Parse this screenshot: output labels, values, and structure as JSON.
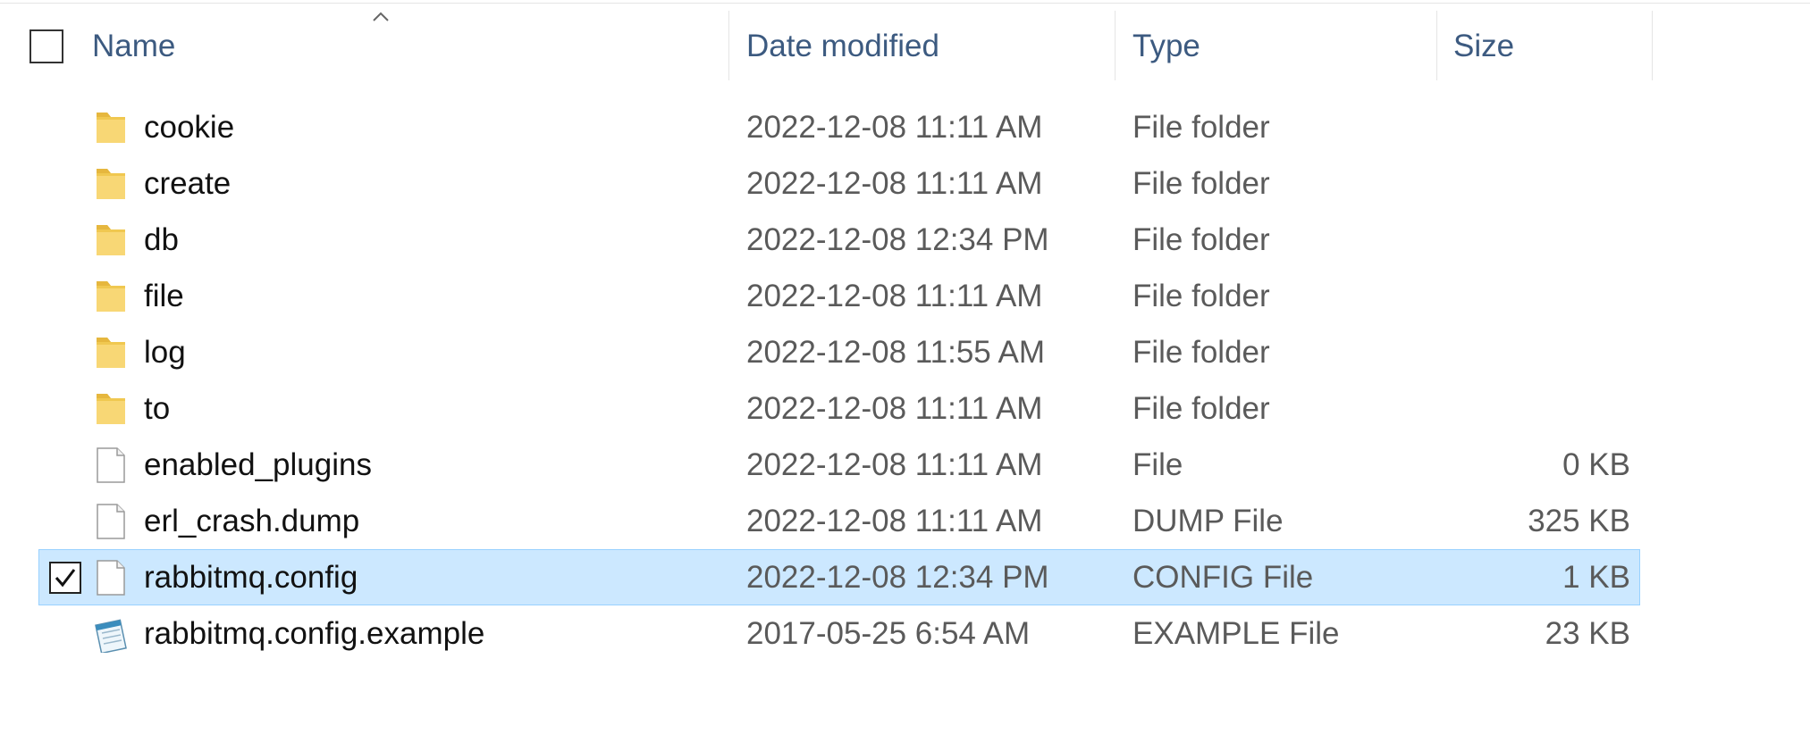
{
  "columns": {
    "name": "Name",
    "date_modified": "Date modified",
    "type": "Type",
    "size": "Size"
  },
  "sort": {
    "column": "name",
    "direction": "ascending",
    "icon": "chevron-up-icon"
  },
  "accent_colors": {
    "header_text": "#3c5a80",
    "selection_fill": "#cce8ff",
    "selection_border": "#99d1ff",
    "folder_icon": "#f8d775"
  },
  "files": [
    {
      "name": "cookie",
      "date": "2022-12-08 11:11 AM",
      "type": "File folder",
      "size": "",
      "icon": "folder-icon",
      "selected": false
    },
    {
      "name": "create",
      "date": "2022-12-08 11:11 AM",
      "type": "File folder",
      "size": "",
      "icon": "folder-icon",
      "selected": false
    },
    {
      "name": "db",
      "date": "2022-12-08 12:34 PM",
      "type": "File folder",
      "size": "",
      "icon": "folder-icon",
      "selected": false
    },
    {
      "name": "file",
      "date": "2022-12-08 11:11 AM",
      "type": "File folder",
      "size": "",
      "icon": "folder-icon",
      "selected": false
    },
    {
      "name": "log",
      "date": "2022-12-08 11:55 AM",
      "type": "File folder",
      "size": "",
      "icon": "folder-icon",
      "selected": false
    },
    {
      "name": "to",
      "date": "2022-12-08 11:11 AM",
      "type": "File folder",
      "size": "",
      "icon": "folder-icon",
      "selected": false
    },
    {
      "name": "enabled_plugins",
      "date": "2022-12-08 11:11 AM",
      "type": "File",
      "size": "0 KB",
      "icon": "blank-file-icon",
      "selected": false
    },
    {
      "name": "erl_crash.dump",
      "date": "2022-12-08 11:11 AM",
      "type": "DUMP File",
      "size": "325 KB",
      "icon": "blank-file-icon",
      "selected": false
    },
    {
      "name": "rabbitmq.config",
      "date": "2022-12-08 12:34 PM",
      "type": "CONFIG File",
      "size": "1 KB",
      "icon": "blank-file-icon",
      "selected": true
    },
    {
      "name": "rabbitmq.config.example",
      "date": "2017-05-25 6:54 AM",
      "type": "EXAMPLE File",
      "size": "23 KB",
      "icon": "notepad-file-icon",
      "selected": false
    }
  ]
}
